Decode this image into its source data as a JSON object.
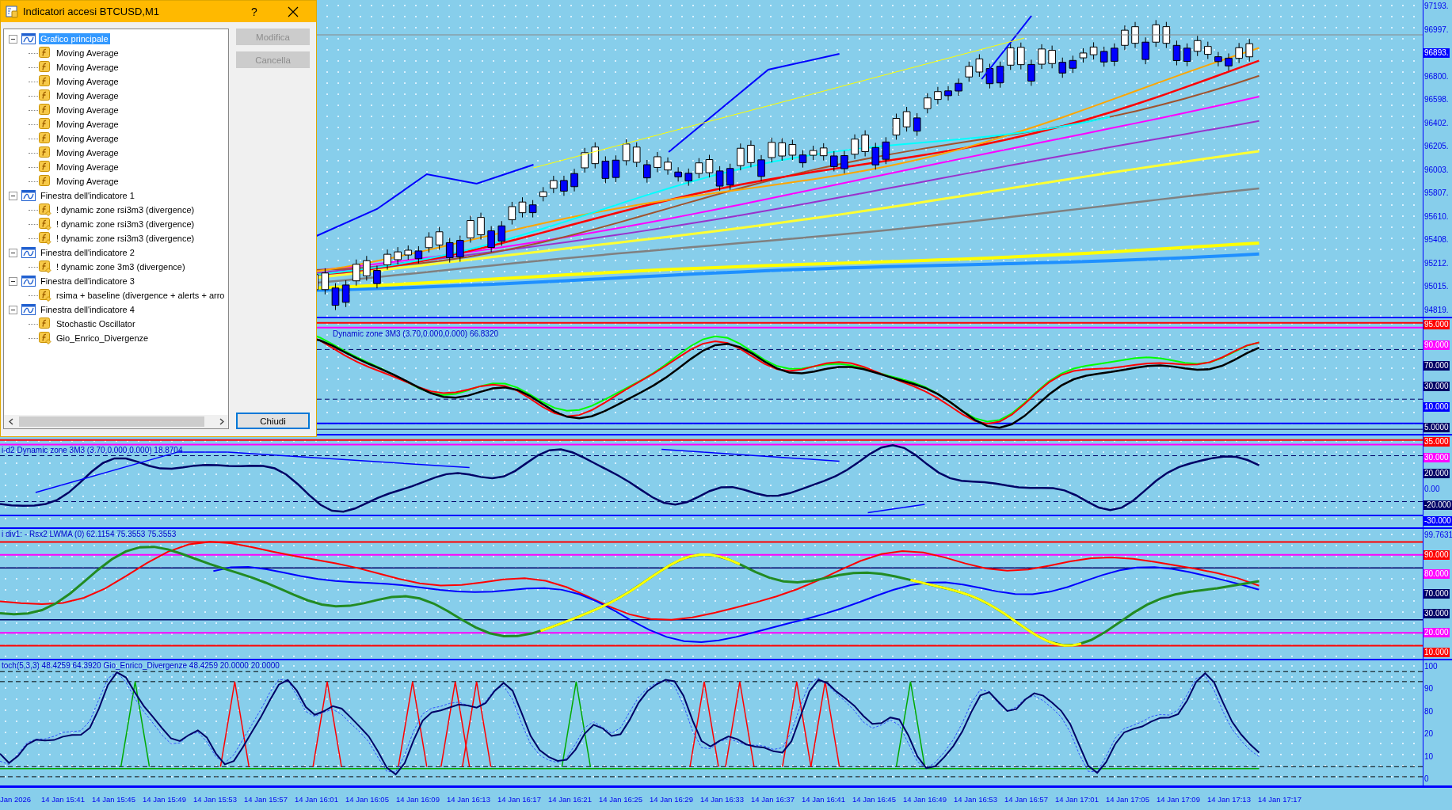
{
  "dialog": {
    "title": "Indicatori accesi BTCUSD,M1",
    "help": "?",
    "tree": [
      {
        "label": "Grafico principale",
        "selected": true,
        "expanded": true,
        "children": [
          {
            "label": "Moving Average",
            "kind": "builtin",
            "selected": false
          },
          {
            "label": "Moving Average",
            "kind": "builtin",
            "selected": false
          },
          {
            "label": "Moving Average",
            "kind": "builtin",
            "selected": false
          },
          {
            "label": "Moving Average",
            "kind": "builtin",
            "selected": false
          },
          {
            "label": "Moving Average",
            "kind": "builtin",
            "selected": false
          },
          {
            "label": "Moving Average",
            "kind": "builtin",
            "selected": false
          },
          {
            "label": "Moving Average",
            "kind": "builtin",
            "selected": false
          },
          {
            "label": "Moving Average",
            "kind": "builtin",
            "selected": false
          },
          {
            "label": "Moving Average",
            "kind": "builtin",
            "selected": false
          },
          {
            "label": "Moving Average",
            "kind": "builtin",
            "selected": false
          }
        ]
      },
      {
        "label": "Finestra dell'indicatore 1",
        "selected": false,
        "expanded": true,
        "children": [
          {
            "label": "! dynamic zone rsi3m3 (divergence)",
            "kind": "custom",
            "selected": false
          },
          {
            "label": "! dynamic zone rsi3m3 (divergence)",
            "kind": "custom",
            "selected": false
          },
          {
            "label": "! dynamic zone rsi3m3 (divergence)",
            "kind": "custom",
            "selected": false
          }
        ]
      },
      {
        "label": "Finestra dell'indicatore 2",
        "selected": false,
        "expanded": true,
        "children": [
          {
            "label": "! dynamic zone 3m3 (divergence)",
            "kind": "custom",
            "selected": false
          }
        ]
      },
      {
        "label": "Finestra dell'indicatore 3",
        "selected": false,
        "expanded": true,
        "children": [
          {
            "label": "rsima + baseline (divergence + alerts + arro",
            "kind": "custom",
            "selected": false
          }
        ]
      },
      {
        "label": "Finestra dell'indicatore 4",
        "selected": false,
        "expanded": true,
        "children": [
          {
            "label": "Stochastic Oscillator",
            "kind": "builtin",
            "selected": false
          },
          {
            "label": "Gio_Enrico_Divergenze",
            "kind": "custom",
            "selected": false
          }
        ]
      }
    ],
    "buttons": [
      {
        "label": "Modifica",
        "disabled": true
      },
      {
        "label": "Cancella",
        "disabled": true
      },
      {
        "label": "Chiudi",
        "disabled": false
      }
    ]
  },
  "chart": {
    "panes": [
      {
        "kind": "price",
        "axis_labels": [
          {
            "text": "97193."
          },
          {
            "text": "96997."
          },
          {
            "text": "96893.",
            "color": "#0000ff"
          },
          {
            "text": "96800."
          },
          {
            "text": "96598."
          },
          {
            "text": "96402."
          },
          {
            "text": "96205."
          },
          {
            "text": "96003."
          },
          {
            "text": "95807."
          },
          {
            "text": "95610."
          },
          {
            "text": "95408."
          },
          {
            "text": "95212."
          },
          {
            "text": "95015."
          },
          {
            "text": "94819."
          }
        ]
      },
      {
        "kind": "zone",
        "title": "Dynamic zone 3M3 (3.70,0.000,0.000) 66.8320",
        "axis_labels": [
          {
            "text": "95.000",
            "color": "#ff0000"
          },
          {
            "text": "90.000",
            "color": "#ff00ff"
          },
          {
            "text": "70.000",
            "color": "#000066"
          },
          {
            "text": "30.000",
            "color": "#000066"
          },
          {
            "text": "10.000",
            "color": "#0000ff"
          },
          {
            "text": "5.0000",
            "color": "#000066"
          }
        ]
      },
      {
        "kind": "zone2",
        "title": "i-d2 Dynamic zone 3M3 (3.70,0.000,0.000) 18.8704",
        "axis_labels": [
          {
            "text": "35.000",
            "color": "#ff0000"
          },
          {
            "text": "30.000",
            "color": "#ff00ff"
          },
          {
            "text": "20.000",
            "color": "#000066"
          },
          {
            "text": "0.00"
          },
          {
            "text": "-20.000",
            "color": "#000066"
          },
          {
            "text": "-30.000",
            "color": "#0000ff"
          }
        ]
      },
      {
        "kind": "rsx",
        "title": "i div1: - Rsx2 LWMA (0) 62.1154 75.3553 75.3553",
        "axis_labels": [
          {
            "text": "99.7631"
          },
          {
            "text": "90.000",
            "color": "#ff0000"
          },
          {
            "text": "80.000",
            "color": "#ff00ff"
          },
          {
            "text": "70.000",
            "color": "#000066"
          },
          {
            "text": "30.000",
            "color": "#000066"
          },
          {
            "text": "20.000",
            "color": "#ff00ff"
          },
          {
            "text": "10.000",
            "color": "#ff0000"
          }
        ]
      },
      {
        "kind": "stoch",
        "title": "toch(5,3,3) 48.4259 64.3920  Gio_Enrico_Divergenze 48.4259 20.0000 20.0000",
        "axis_labels": [
          {
            "text": "100"
          },
          {
            "text": "90"
          },
          {
            "text": "80"
          },
          {
            "text": "20"
          },
          {
            "text": "10"
          },
          {
            "text": "0"
          }
        ]
      }
    ],
    "time_axis": [
      "Jan 2026",
      "14 Jan 15:41",
      "14 Jan 15:45",
      "14 Jan 15:49",
      "14 Jan 15:53",
      "14 Jan 15:57",
      "14 Jan 16:01",
      "14 Jan 16:05",
      "14 Jan 16:09",
      "14 Jan 16:13",
      "14 Jan 16:17",
      "14 Jan 16:21",
      "14 Jan 16:25",
      "14 Jan 16:29",
      "14 Jan 16:33",
      "14 Jan 16:37",
      "14 Jan 16:41",
      "14 Jan 16:45",
      "14 Jan 16:49",
      "14 Jan 16:53",
      "14 Jan 16:57",
      "14 Jan 17:01",
      "14 Jan 17:05",
      "14 Jan 17:09",
      "14 Jan 17:13",
      "14 Jan 17:17"
    ]
  }
}
